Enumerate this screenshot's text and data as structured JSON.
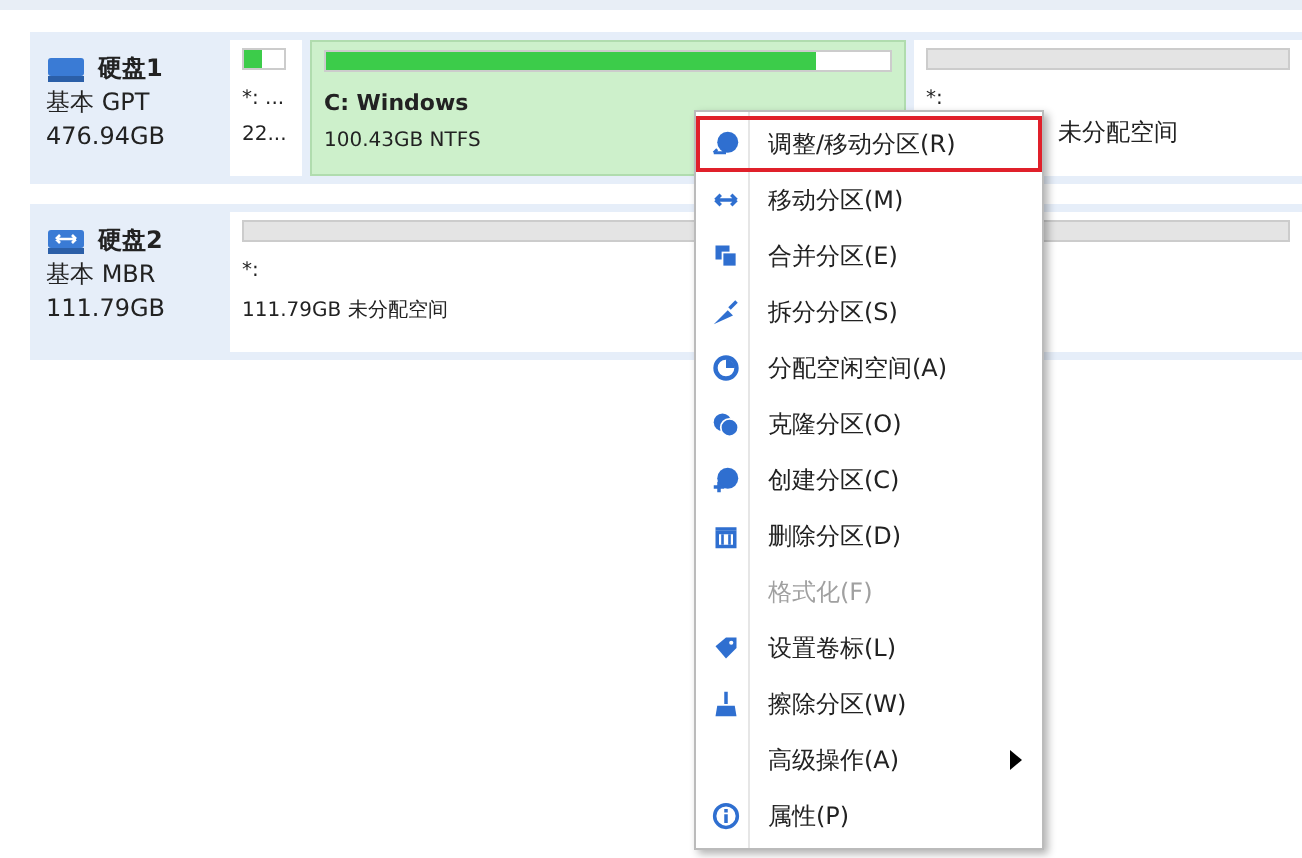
{
  "disks": [
    {
      "name": "硬盘1",
      "type": "基本 GPT",
      "size": "476.94GB",
      "partitions": [
        {
          "label": "*: ...",
          "info": "22...",
          "level": 0.45,
          "selected": false,
          "kind": "small"
        },
        {
          "label": "C: Windows",
          "info": "100.43GB NTFS",
          "level": 0.87,
          "selected": true,
          "kind": "wide"
        },
        {
          "label": "*:",
          "info": "未分配空间",
          "selected": false,
          "kind": "covered"
        }
      ]
    },
    {
      "name": "硬盘2",
      "type": "基本 MBR",
      "size": "111.79GB",
      "partitions": [
        {
          "label": "*:",
          "info": "111.79GB 未分配空间",
          "selected": false,
          "kind": "full"
        }
      ]
    }
  ],
  "context_menu": {
    "items": [
      {
        "label": "调整/移动分区(R)",
        "highlighted": true,
        "disabled": false,
        "submenu": false
      },
      {
        "label": "移动分区(M)",
        "highlighted": false,
        "disabled": false,
        "submenu": false
      },
      {
        "label": "合并分区(E)",
        "highlighted": false,
        "disabled": false,
        "submenu": false
      },
      {
        "label": "拆分分区(S)",
        "highlighted": false,
        "disabled": false,
        "submenu": false
      },
      {
        "label": "分配空闲空间(A)",
        "highlighted": false,
        "disabled": false,
        "submenu": false
      },
      {
        "label": "克隆分区(O)",
        "highlighted": false,
        "disabled": false,
        "submenu": false
      },
      {
        "label": "创建分区(C)",
        "highlighted": false,
        "disabled": false,
        "submenu": false
      },
      {
        "label": "删除分区(D)",
        "highlighted": false,
        "disabled": false,
        "submenu": false
      },
      {
        "label": "格式化(F)",
        "highlighted": false,
        "disabled": true,
        "submenu": false
      },
      {
        "label": "设置卷标(L)",
        "highlighted": false,
        "disabled": false,
        "submenu": false
      },
      {
        "label": "擦除分区(W)",
        "highlighted": false,
        "disabled": false,
        "submenu": false
      },
      {
        "label": "高级操作(A)",
        "highlighted": false,
        "disabled": false,
        "submenu": true
      },
      {
        "label": "属性(P)",
        "highlighted": false,
        "disabled": false,
        "submenu": false
      }
    ]
  }
}
